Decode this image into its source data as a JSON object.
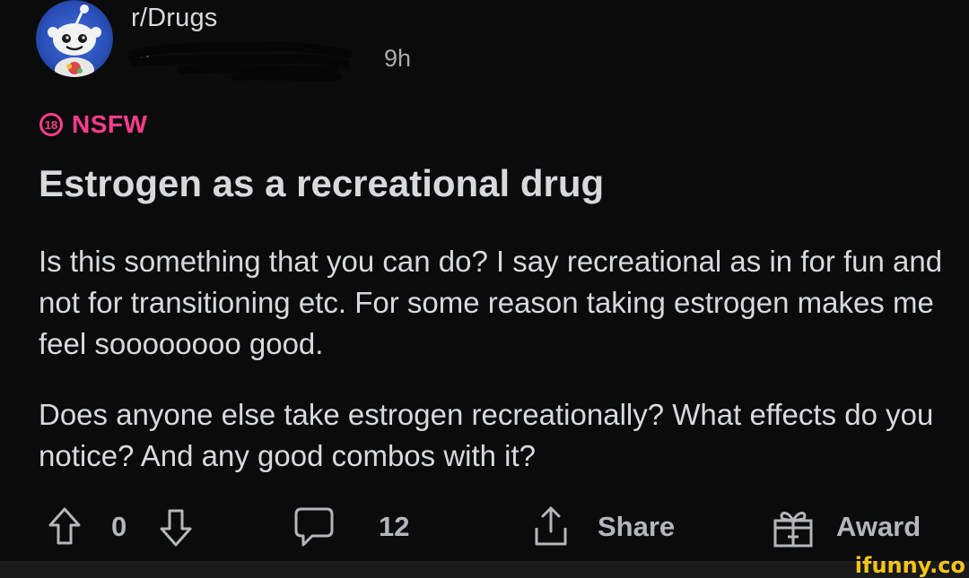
{
  "post": {
    "subreddit": "r/Drugs",
    "author": "u/",
    "time": "9h",
    "nsfw_age": "18",
    "nsfw_label": "NSFW",
    "title": "Estrogen as a recreational drug",
    "body": [
      "Is this something that you can do? I say recreational as in for fun and not for transitioning etc. For some reason taking estrogen makes me feel soooooooo good.",
      "Does anyone else take estrogen recreationally? What effects do you notice? And any good combos with it?"
    ]
  },
  "actions": {
    "vote_count": "0",
    "comment_count": "12",
    "share_label": "Share",
    "award_label": "Award"
  },
  "watermark": "ifunny.co",
  "icons": {
    "avatar": "snoo-avatar-icon",
    "upvote": "arrow-up-icon",
    "downvote": "arrow-down-icon",
    "comment": "comment-bubble-icon",
    "share": "share-icon",
    "award": "gift-icon"
  },
  "colors": {
    "background": "#0b0b0c",
    "text": "#d7dadc",
    "nsfw": "#ff3c8d",
    "muted": "#b4b7ba",
    "watermark": "#f5c518"
  }
}
